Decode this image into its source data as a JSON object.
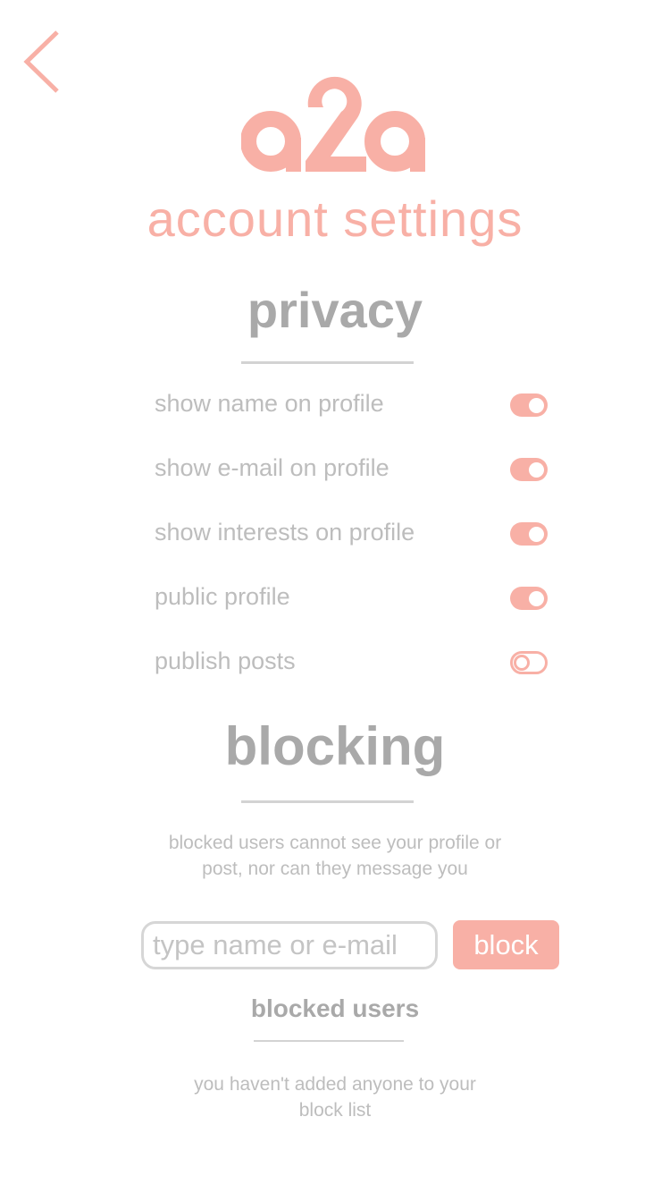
{
  "header": {
    "logo_text": "a2a",
    "title": "account settings"
  },
  "privacy": {
    "heading": "privacy",
    "settings": [
      {
        "label": "show name on profile",
        "on": true
      },
      {
        "label": "show e-mail on profile",
        "on": true
      },
      {
        "label": "show interests on profile",
        "on": true
      },
      {
        "label": "public profile",
        "on": true
      },
      {
        "label": "publish posts",
        "on": false
      }
    ]
  },
  "blocking": {
    "heading": "blocking",
    "description_line1": "blocked users cannot see your profile or",
    "description_line2": "post, nor can they message you",
    "input_placeholder": "type name or e-mail",
    "input_value": "",
    "block_label": "block",
    "list_heading": "blocked users",
    "empty_line1": "you haven't added anyone to your",
    "empty_line2": "block list"
  },
  "colors": {
    "accent": "#f8b0a6",
    "gray": "#a9a9a9"
  }
}
